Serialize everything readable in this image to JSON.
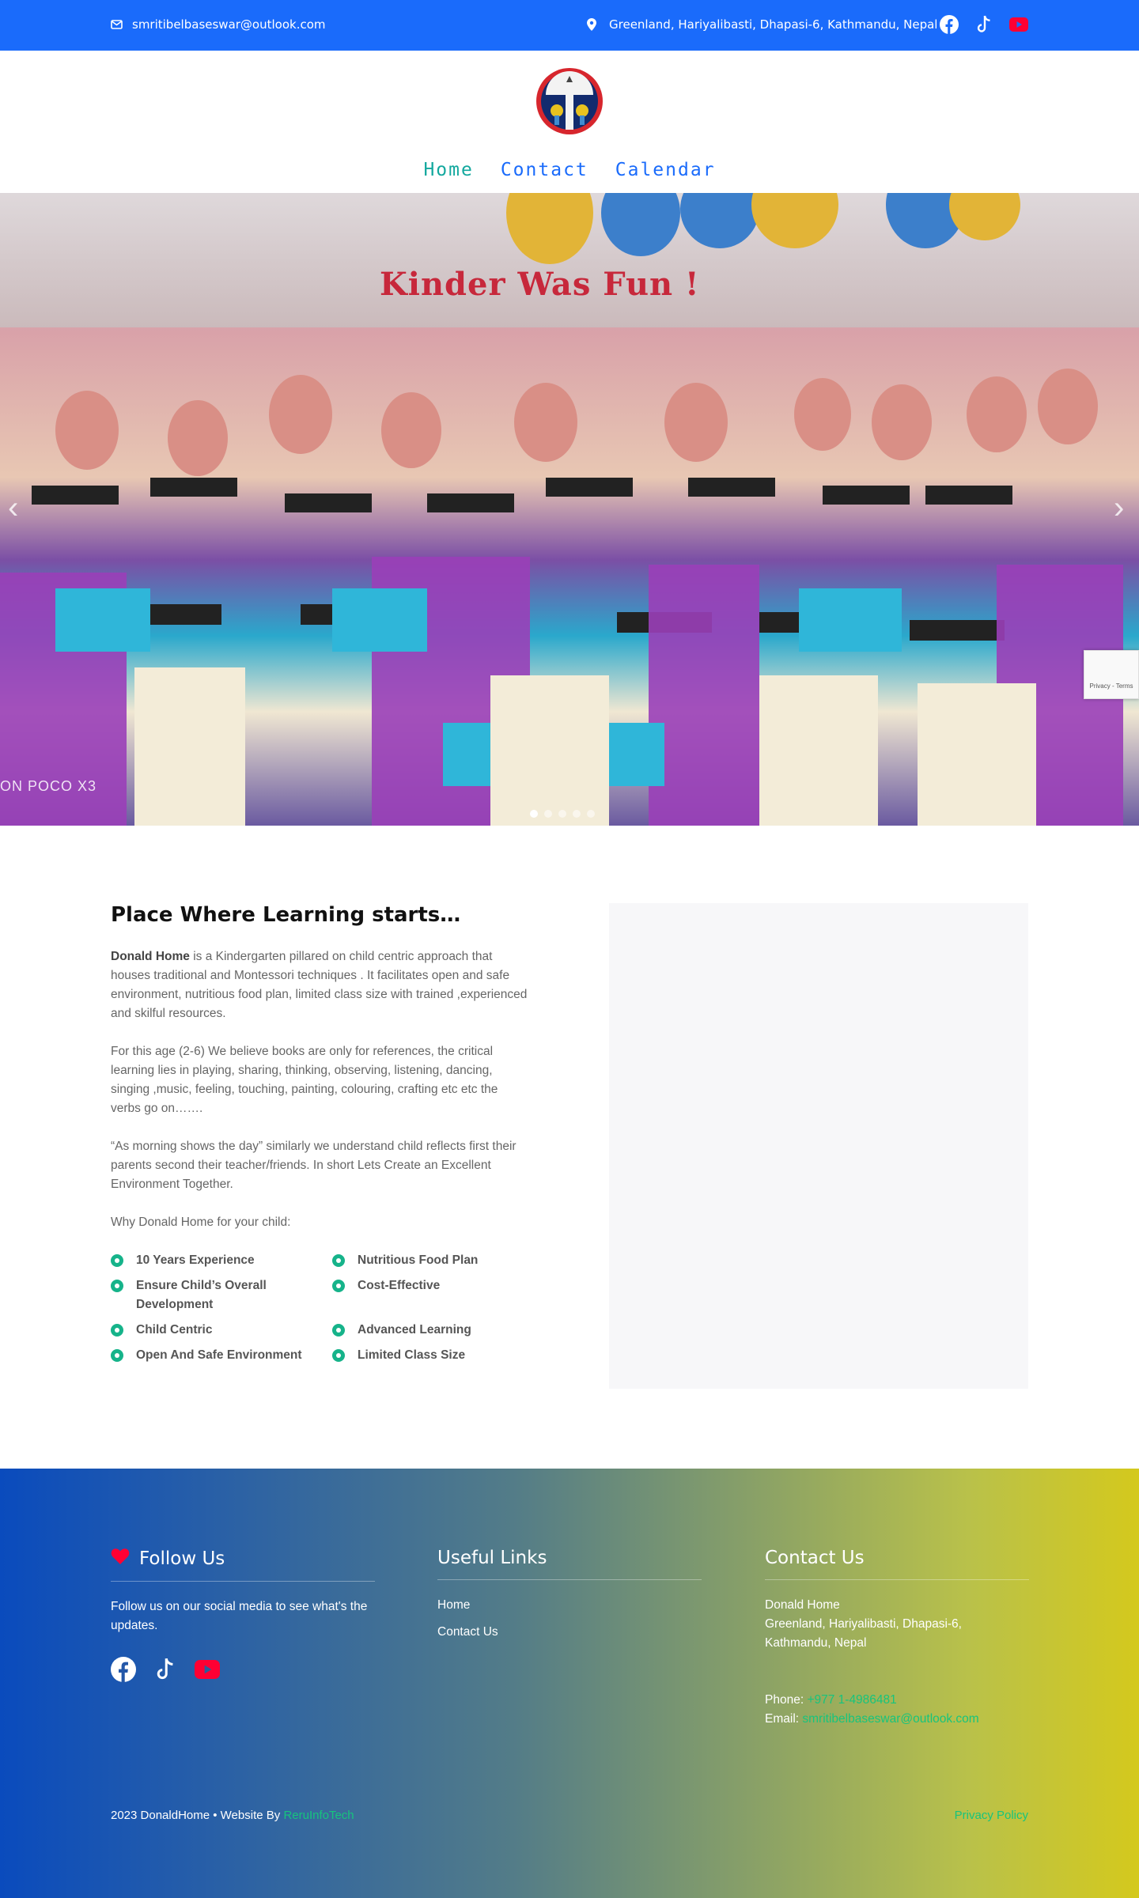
{
  "topbar": {
    "email": "smritibelbaseswar@outlook.com",
    "address": "Greenland, Hariyalibasti, Dhapasi-6, Kathmandu, Nepal",
    "socials": [
      "facebook-icon",
      "tiktok-icon",
      "youtube-icon"
    ]
  },
  "nav": {
    "items": [
      {
        "label": "Home",
        "active": true
      },
      {
        "label": "Contact",
        "active": false
      },
      {
        "label": "Calendar",
        "active": false
      }
    ]
  },
  "hero": {
    "banner_text": "Kinder Was Fun !",
    "watermark": "ON POCO X3",
    "slides": 5,
    "active_slide": 1
  },
  "about": {
    "title": "Place Where Learning starts…",
    "brand": "Donald Home",
    "p1": " is a Kindergarten pillared on child centric approach that houses traditional and Montessori techniques . It facilitates open and safe environment, nutritious food plan, limited class size with trained ,experienced and skilful resources.",
    "p2": "For this age (2-6) We believe books are only for references, the critical learning lies in playing, sharing, thinking, observing, listening, dancing, singing ,music, feeling, touching, painting, colouring, crafting etc etc the verbs go on…….",
    "p3": "“As morning shows the day” similarly we understand child reflects first their parents second their teacher/friends. In short Lets Create an Excellent Environment Together.",
    "p4": "Why Donald Home for your child:",
    "features_left": [
      "10 Years Experience",
      "Ensure Child’s Overall Development",
      "Child Centric",
      "Open And Safe Environment"
    ],
    "features_right": [
      "Nutritious Food Plan",
      "Cost-Effective",
      "Advanced Learning",
      "Limited Class Size"
    ]
  },
  "footer": {
    "follow": {
      "title": "Follow Us",
      "text": "Follow us on our social media to see what's the updates."
    },
    "links": {
      "title": "Useful Links",
      "items": [
        "Home",
        "Contact Us"
      ]
    },
    "contact": {
      "title": "Contact Us",
      "name": "Donald Home",
      "address": "Greenland, Hariyalibasti, Dhapasi-6, Kathmandu, Nepal",
      "phone_label": "Phone: ",
      "phone": "+977 1-4986481",
      "email_label": "Email: ",
      "email": "smritibelbaseswar@outlook.com"
    },
    "copyright": "2023 DonaldHome • Website By ",
    "credit": "ReruInfoTech",
    "privacy": "Privacy Policy"
  },
  "recaptcha": "Privacy - Terms",
  "colors": {
    "topbar": "#1a6bfb",
    "accent_green": "#13a89e",
    "youtube": "#ff0033"
  }
}
